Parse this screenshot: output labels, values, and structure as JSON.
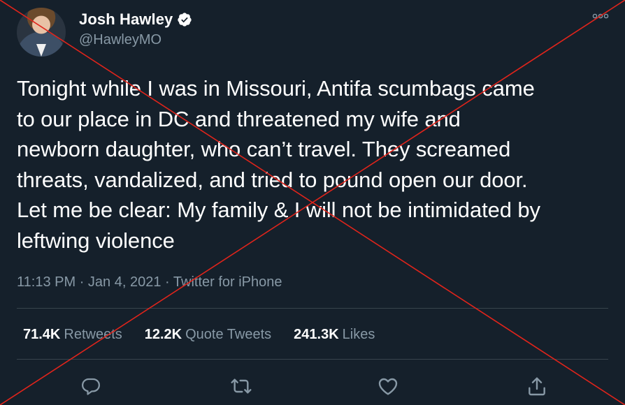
{
  "author": {
    "name": "Josh Hawley",
    "handle": "@HawleyMO",
    "verified": true,
    "avatar_icon": "user-photo-avatar"
  },
  "tweet": {
    "text": "Tonight while I was in Missouri, Antifa scumbags came\nto our place in DC and threatened my wife and\nnewborn daughter, who can’t travel. They screamed\nthreats, vandalized, and tried to pound open our door.\nLet me be clear: My family & I will not be intimidated by\nleftwing violence",
    "time": "11:13 PM",
    "date": "Jan 4, 2021",
    "separator": "·",
    "source": "Twitter for iPhone"
  },
  "stats": {
    "retweets_count": "71.4K",
    "retweets_label": "Retweets",
    "quotes_count": "12.2K",
    "quotes_label": "Quote Tweets",
    "likes_count": "241.3K",
    "likes_label": "Likes"
  },
  "actions": [
    "reply-icon",
    "retweet-icon",
    "like-icon",
    "share-icon"
  ],
  "overlay": {
    "type": "red-x-cross",
    "color": "#e0241b"
  },
  "colors": {
    "background": "#15202b",
    "text": "#ffffff",
    "secondary": "#8899a6",
    "divider": "#38444d",
    "verified": "#ffffff"
  }
}
